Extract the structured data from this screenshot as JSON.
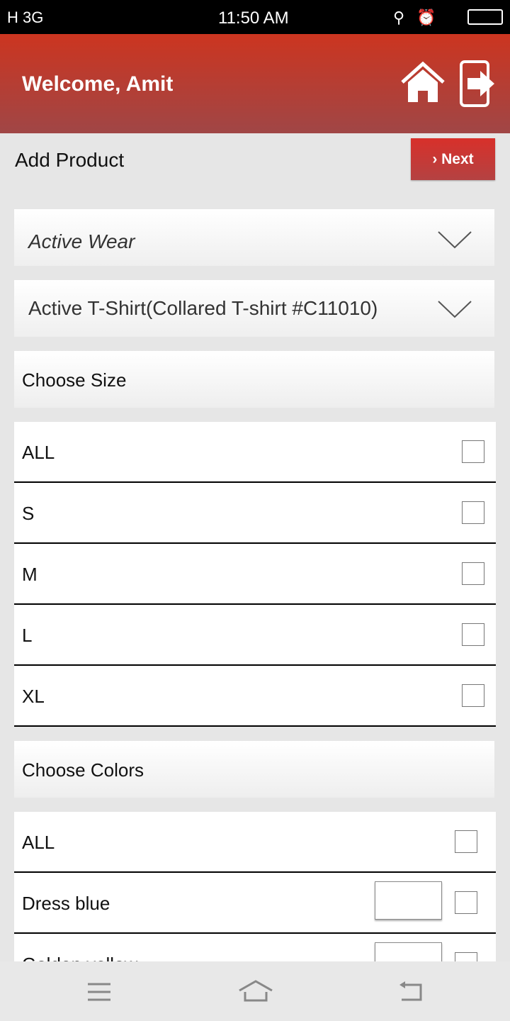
{
  "status_bar": {
    "left": "H 3G",
    "time": "11:50 AM"
  },
  "header": {
    "title": "Welcome, Amit",
    "icons": [
      "home-icon",
      "logout-icon"
    ]
  },
  "page": {
    "title": "Add Product",
    "next_label": "Next"
  },
  "dropdowns": [
    {
      "value": "Active Wear"
    },
    {
      "value": "Active T-Shirt(Collared T-shirt #C11010)"
    }
  ],
  "sizes": {
    "title": "Choose Size",
    "items": [
      "ALL",
      "S",
      "M",
      "L",
      "XL"
    ]
  },
  "colors": {
    "title": "Choose Colors",
    "items": [
      {
        "label": "ALL",
        "swatch": false
      },
      {
        "label": "Dress blue",
        "swatch": true
      },
      {
        "label": "Golden yellow",
        "swatch": true
      }
    ]
  },
  "accent": "#cc3520"
}
